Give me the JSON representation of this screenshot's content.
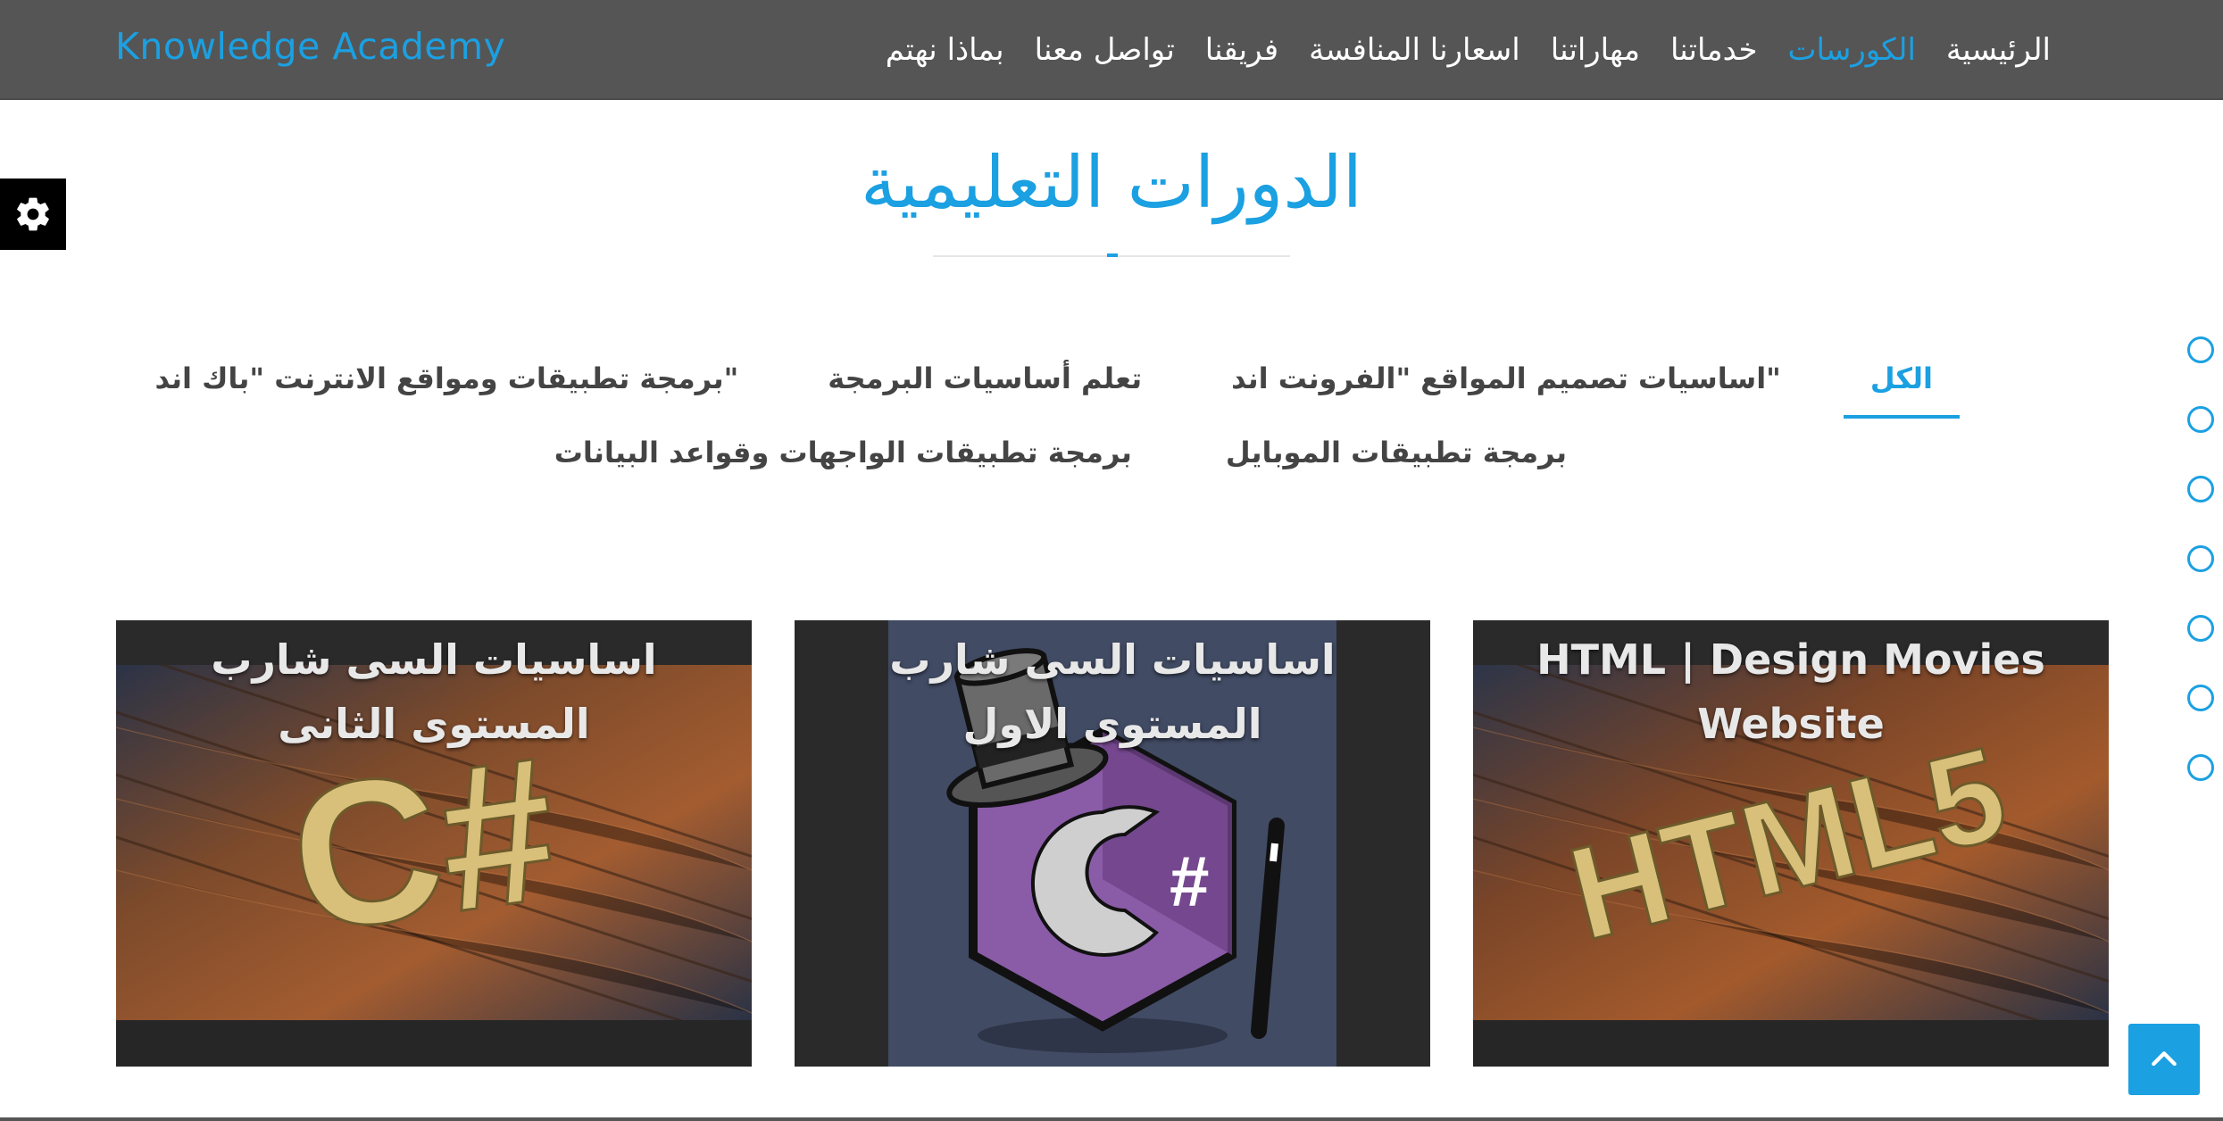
{
  "brand": "Knowledge Academy",
  "nav": {
    "items": [
      {
        "label": "الرئيسية",
        "active": false
      },
      {
        "label": "الكورسات",
        "active": true
      },
      {
        "label": "خدماتنا",
        "active": false
      },
      {
        "label": "مهاراتنا",
        "active": false
      },
      {
        "label": "اسعارنا المنافسة",
        "active": false
      },
      {
        "label": "فريقنا",
        "active": false
      },
      {
        "label": "تواصل معنا",
        "active": false
      },
      {
        "label": "بماذا نهتم",
        "active": false
      }
    ]
  },
  "section": {
    "title": "الدورات التعليمية"
  },
  "filters": {
    "row1": [
      {
        "label": "الكل",
        "active": true
      },
      {
        "label": "اساسيات تصميم المواقع \"الفرونت اند\"",
        "active": false
      },
      {
        "label": "تعلم أساسيات البرمجة",
        "active": false
      },
      {
        "label": "برمجة تطبيقات ومواقع الانترنت \"باك اند\"",
        "active": false
      }
    ],
    "row2": [
      {
        "label": "برمجة تطبيقات الموبايل",
        "active": false
      },
      {
        "label": "برمجة تطبيقات الواجهات وقواعد البيانات",
        "active": false
      }
    ]
  },
  "cards": [
    {
      "title": "HTML | Design Movies Website",
      "image": "html5-wood"
    },
    {
      "title": "اساسيات السى شارب المستوى الاول",
      "image": "csharp-logo-hat"
    },
    {
      "title": "اساسيات السى شارب المستوى الثانى",
      "image": "csharp-wood"
    }
  ],
  "icons": {
    "settings": "gear-icon",
    "back_to_top": "chevron-up-icon"
  },
  "colors": {
    "accent": "#1ba0e2",
    "navbar": "#555555"
  }
}
